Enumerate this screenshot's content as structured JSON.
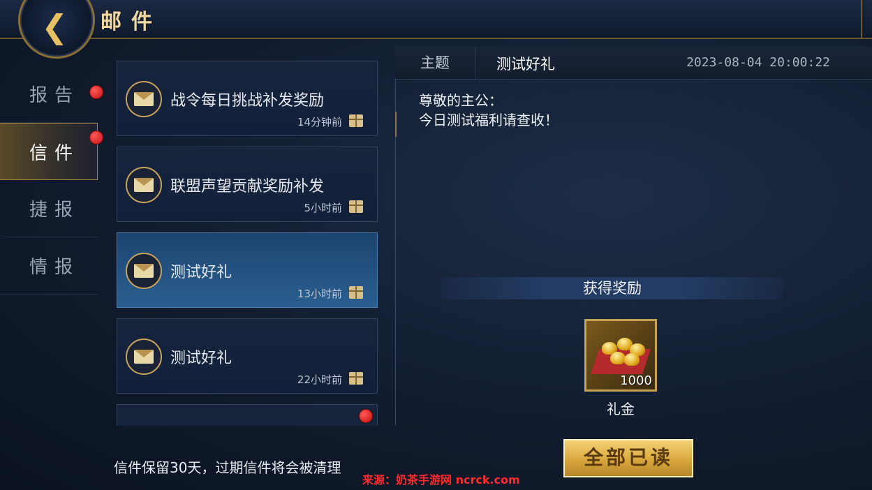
{
  "header": {
    "title": "邮件",
    "back_icon": "chevron-left-icon"
  },
  "tabs": [
    {
      "label": "报告",
      "badge": true
    },
    {
      "label": "信件",
      "badge": true,
      "active": true
    },
    {
      "label": "捷报",
      "badge": false
    },
    {
      "label": "情报",
      "badge": false
    }
  ],
  "mails": [
    {
      "title": "战令每日挑战补发奖励",
      "time": "14分钟前",
      "icon": "envelope-icon",
      "attachment_icon": "gift-icon"
    },
    {
      "title": "联盟声望贡献奖励补发",
      "time": "5小时前",
      "icon": "envelope-icon",
      "attachment_icon": "gift-icon"
    },
    {
      "title": "测试好礼",
      "time": "13小时前",
      "icon": "envelope-icon",
      "attachment_icon": "gift-icon",
      "selected": true
    },
    {
      "title": "测试好礼",
      "time": "22小时前",
      "icon": "envelope-icon",
      "attachment_icon": "gift-icon"
    }
  ],
  "detail": {
    "subject_label": "主题",
    "subject": "测试好礼",
    "date": "2023-08-04 20:00:22",
    "greeting": "尊敬的主公：",
    "body": "今日测试福利请查收！",
    "reward_header": "获得奖励",
    "reward": {
      "name": "礼金",
      "count": "1000",
      "icon": "gold-ingot-icon"
    }
  },
  "footer": {
    "note": "信件保留30天，过期信件将会被清理",
    "read_all_label": "全部已读"
  },
  "watermark": "来源：奶茶手游网 ncrck.com",
  "colors": {
    "accent_gold": "#c8a450",
    "selected_blue": "#2a5f90",
    "badge_red": "#c81010"
  }
}
